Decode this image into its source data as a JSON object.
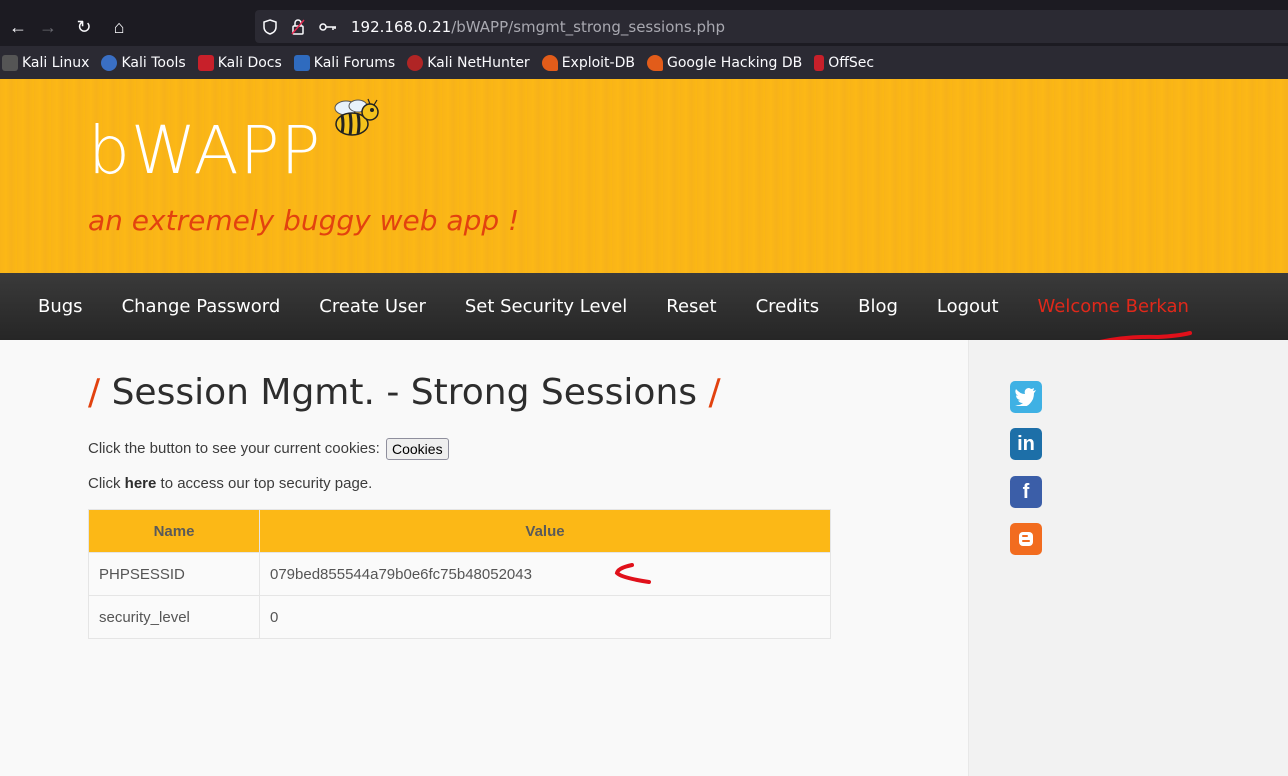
{
  "browser": {
    "url_host": "192.168.0.21",
    "url_path": "/bWAPP/smgmt_strong_sessions.php",
    "bookmarks": [
      {
        "label": "Kali Linux",
        "icon": "kali-dragon-icon",
        "color": "#555555"
      },
      {
        "label": "Kali Tools",
        "icon": "kali-tools-icon",
        "color": "#3a6fc4"
      },
      {
        "label": "Kali Docs",
        "icon": "kali-docs-icon",
        "color": "#c8202a"
      },
      {
        "label": "Kali Forums",
        "icon": "kali-forums-icon",
        "color": "#2f6bbf"
      },
      {
        "label": "Kali NetHunter",
        "icon": "kali-nethunter-icon",
        "color": "#b02525"
      },
      {
        "label": "Exploit-DB",
        "icon": "exploit-db-icon",
        "color": "#e25c1a"
      },
      {
        "label": "Google Hacking DB",
        "icon": "ghdb-icon",
        "color": "#e25c1a"
      },
      {
        "label": "OffSec",
        "icon": "offsec-icon",
        "color": "#c8202a"
      }
    ]
  },
  "header": {
    "logo": "bWAPP",
    "tagline": "an extremely buggy web app !"
  },
  "menu": {
    "items": [
      "Bugs",
      "Change Password",
      "Create User",
      "Set Security Level",
      "Reset",
      "Credits",
      "Blog",
      "Logout"
    ],
    "welcome": "Welcome Berkan"
  },
  "main": {
    "title": "Session Mgmt. - Strong Sessions",
    "cookies_text": "Click the button to see your current cookies:",
    "cookies_button": "Cookies",
    "click_text": "Click",
    "here_link": "here",
    "access_text": "to access our top security page.",
    "table": {
      "headers": [
        "Name",
        "Value"
      ],
      "rows": [
        [
          "PHPSESSID",
          "079bed855544a79b0e6fc75b48052043"
        ],
        [
          "security_level",
          "0"
        ]
      ]
    }
  },
  "sidebar": {
    "social": [
      "twitter-icon",
      "linkedin-icon",
      "facebook-icon",
      "blogger-icon"
    ]
  },
  "colors": {
    "accent": "#fcb816",
    "brand_red": "#e2420f",
    "menu_bg": "#2e2e2e"
  }
}
